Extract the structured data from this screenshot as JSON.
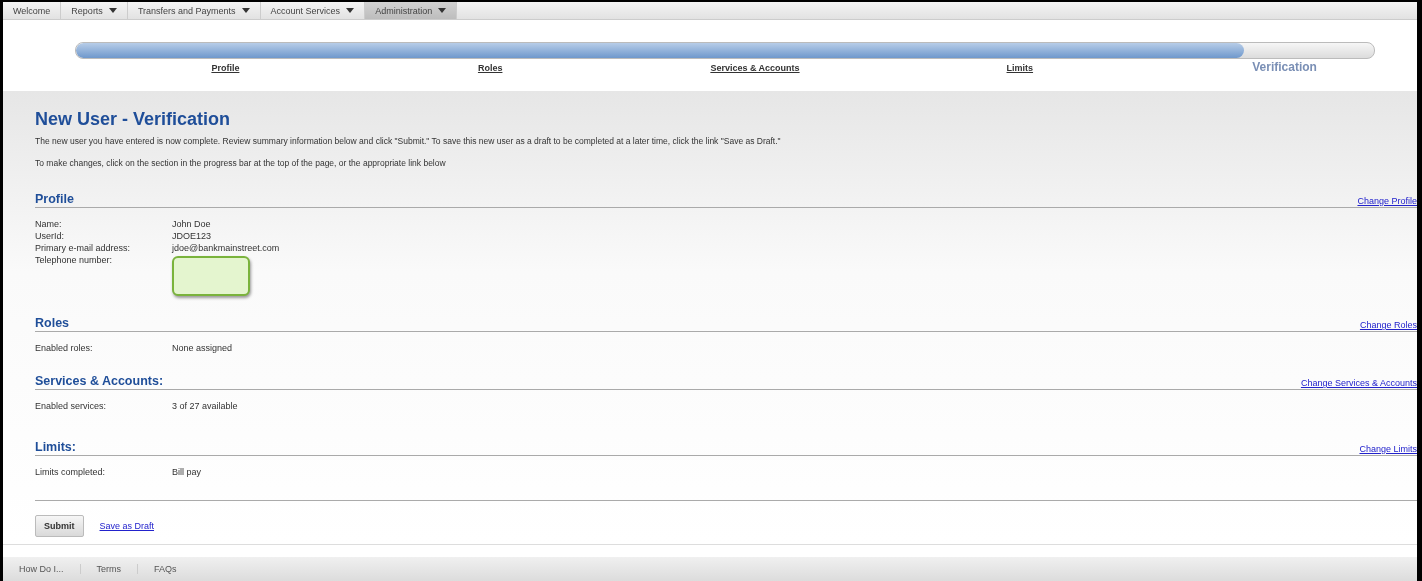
{
  "nav": [
    {
      "label": "Welcome",
      "dropdown": false,
      "selected": false
    },
    {
      "label": "Reports",
      "dropdown": true,
      "selected": false
    },
    {
      "label": "Transfers and Payments",
      "dropdown": true,
      "selected": false
    },
    {
      "label": "Account Services",
      "dropdown": true,
      "selected": false
    },
    {
      "label": "Administration",
      "dropdown": true,
      "selected": true
    }
  ],
  "progress": {
    "level": 0.9,
    "steps": [
      {
        "label": "Profile",
        "selected": false
      },
      {
        "label": "Roles",
        "selected": false
      },
      {
        "label": "Services & Accounts",
        "selected": false
      },
      {
        "label": "Limits",
        "selected": false
      },
      {
        "label": "Verification",
        "selected": true
      }
    ]
  },
  "title": "New User - Verification",
  "intro": [
    "The new user you have entered is now complete. Review summary information below and click \"Submit.\" To save this new user as a draft to be completed at a later time, click the link \"Save as Draft.\"",
    "To make changes, click on the section in the progress bar at the top of the page, or the appropriate link below"
  ],
  "sections": [
    {
      "title": "Profile",
      "link": "Change Profile",
      "rows": [
        {
          "label": "Name:",
          "value": "John Doe",
          "highlighted": false
        },
        {
          "label": "UserId:",
          "value": "JDOE123",
          "highlighted": false
        },
        {
          "label": "Primary e-mail address:",
          "value": "jdoe@bankmainstreet.com",
          "highlighted": false
        },
        {
          "label": "Telephone number:",
          "highlighted": true
        }
      ]
    },
    {
      "title": "Roles",
      "link": "Change Roles",
      "rows": [
        {
          "label": "Enabled roles:",
          "value": "None assigned",
          "highlighted": false
        }
      ]
    },
    {
      "title": "Services & Accounts:",
      "link": "Change Services & Accounts",
      "rows": [
        {
          "label": "Enabled services:",
          "value": "3 of 27 available",
          "highlighted": false
        }
      ]
    },
    {
      "title": "Limits:",
      "link": "Change Limits",
      "rows": [
        {
          "label": "Limits completed:",
          "value": "Bill pay",
          "highlighted": false
        }
      ]
    }
  ],
  "actions": {
    "submit": "Submit",
    "draft": "Save as Draft"
  },
  "footer": [
    "How Do I...",
    "Terms",
    "FAQs"
  ]
}
